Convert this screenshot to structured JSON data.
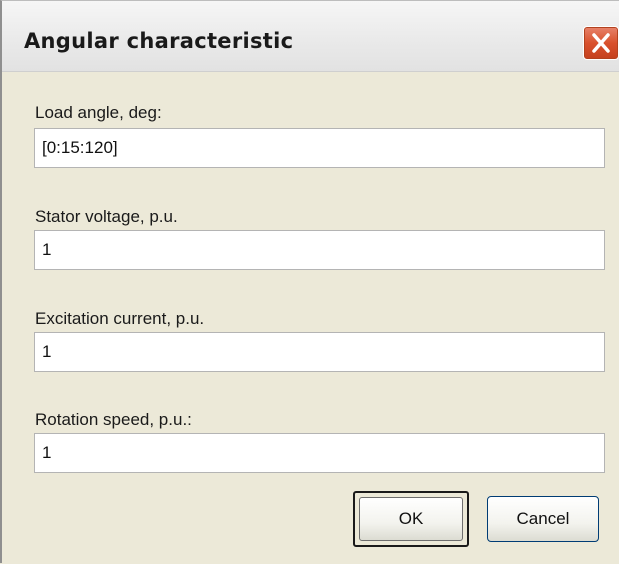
{
  "window": {
    "title": "Angular characteristic"
  },
  "fields": [
    {
      "label": "Load angle, deg:",
      "value": "[0:15:120]"
    },
    {
      "label": "Stator voltage, p.u.",
      "value": "1"
    },
    {
      "label": "Excitation current, p.u.",
      "value": "1"
    },
    {
      "label": "Rotation speed, p.u.:",
      "value": "1"
    }
  ],
  "buttons": {
    "ok_label": "OK",
    "cancel_label": "Cancel"
  },
  "icons": {
    "close": "close-icon"
  },
  "colors": {
    "close_button": "#d9512d",
    "dialog_background": "#ece9d8"
  }
}
